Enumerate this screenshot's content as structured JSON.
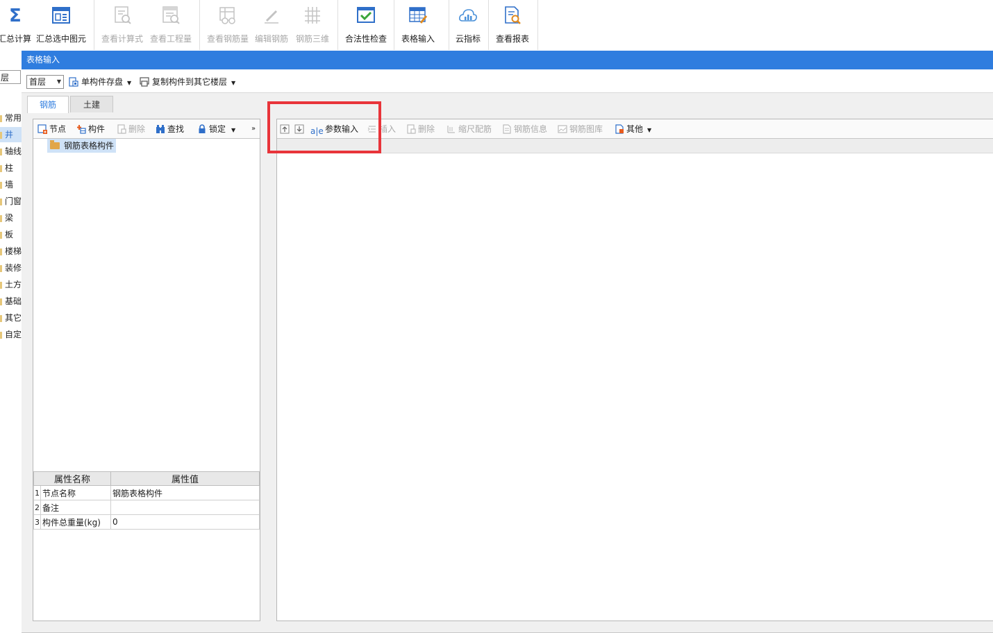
{
  "ribbon": {
    "buttons": [
      {
        "id": "sum-calc",
        "label": "汇总计算",
        "disabled": false,
        "icon": "sigma-icon"
      },
      {
        "id": "sum-selected",
        "label": "汇总选中图元",
        "disabled": false,
        "icon": "calculator-window-icon"
      },
      {
        "id": "view-formula",
        "label": "查看计算式",
        "disabled": true,
        "icon": "formula-magnifier-icon"
      },
      {
        "id": "view-quantity",
        "label": "查看工程量",
        "disabled": true,
        "icon": "quantity-magnifier-icon"
      },
      {
        "id": "view-rebar-qty",
        "label": "查看钢筋量",
        "disabled": true,
        "icon": "rebar-quantity-icon"
      },
      {
        "id": "edit-rebar",
        "label": "编辑钢筋",
        "disabled": true,
        "icon": "pencil-icon"
      },
      {
        "id": "rebar-3d",
        "label": "钢筋三维",
        "disabled": true,
        "icon": "rebar-3d-icon"
      },
      {
        "id": "validity-check",
        "label": "合法性检查",
        "disabled": false,
        "icon": "checkmark-window-icon"
      },
      {
        "id": "table-input",
        "label": "表格输入",
        "disabled": false,
        "icon": "table-pencil-icon"
      },
      {
        "id": "cloud-index",
        "label": "云指标",
        "disabled": false,
        "icon": "cloud-chart-icon"
      },
      {
        "id": "view-report",
        "label": "查看报表",
        "disabled": false,
        "icon": "report-magnifier-icon"
      }
    ]
  },
  "leftstrip": {
    "floor": "层",
    "categories": [
      "常用",
      "井",
      "轴线",
      "柱",
      "墙",
      "门窗",
      "梁",
      "板",
      "楼梯",
      "装修",
      "土方",
      "基础",
      "其它",
      "自定"
    ]
  },
  "window": {
    "title": "表格输入",
    "floor_select": "首层",
    "save_single": "单构件存盘",
    "copy_to_floor": "复制构件到其它楼层",
    "tabs": [
      "钢筋",
      "土建"
    ]
  },
  "left_toolbar": {
    "node": "节点",
    "component": "构件",
    "delete": "删除",
    "find": "查找",
    "lock": "锁定",
    "more": "»"
  },
  "tree": {
    "root": "钢筋表格构件"
  },
  "properties": {
    "headers": [
      "属性名称",
      "属性值"
    ],
    "rows": [
      {
        "num": "1",
        "name": "节点名称",
        "value": "钢筋表格构件"
      },
      {
        "num": "2",
        "name": "备注",
        "value": ""
      },
      {
        "num": "3",
        "name": "构件总重量(kg)",
        "value": "0"
      }
    ]
  },
  "right_toolbar": {
    "param_input": "参数输入",
    "insert": "插入",
    "delete": "删除",
    "scale_rebar": "缩尺配筋",
    "rebar_info": "钢筋信息",
    "rebar_library": "钢筋图库",
    "other": "其他"
  },
  "colors": {
    "title_bar": "#2f7ddf",
    "highlight": "#e8343a",
    "selection": "#cfe2f7"
  }
}
